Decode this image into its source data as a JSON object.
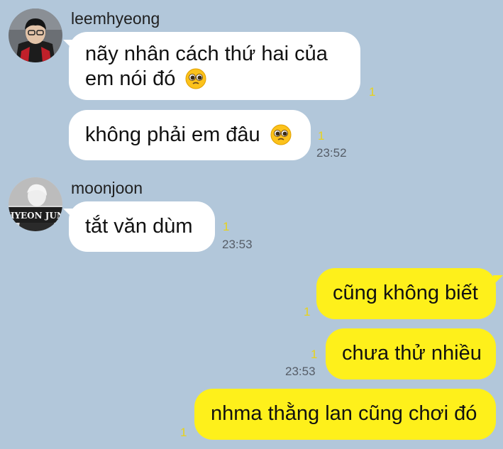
{
  "messages": [
    {
      "sender": "leemhyeong",
      "text_line1": "nãy nhân cách thứ hai của",
      "text_line2": "em nói đó",
      "unread": "1"
    },
    {
      "text": "không phải em đâu",
      "unread": "1",
      "time": "23:52"
    },
    {
      "sender": "moonjoon",
      "text": "tắt văn dùm",
      "unread": "1",
      "time": "23:53",
      "avatar_text": "HYEON JUN"
    },
    {
      "text": "cũng không biết",
      "unread": "1"
    },
    {
      "text": "chưa thử nhiều",
      "unread": "1",
      "time": "23:53"
    },
    {
      "text": "nhma thằng lan cũng chơi đó",
      "unread": "1"
    }
  ],
  "colors": {
    "background": "#b2c7da",
    "incoming": "#ffffff",
    "outgoing": "#fef01b",
    "unread": "#e8d21c"
  },
  "icons": [
    "pleading-face-emoji"
  ]
}
